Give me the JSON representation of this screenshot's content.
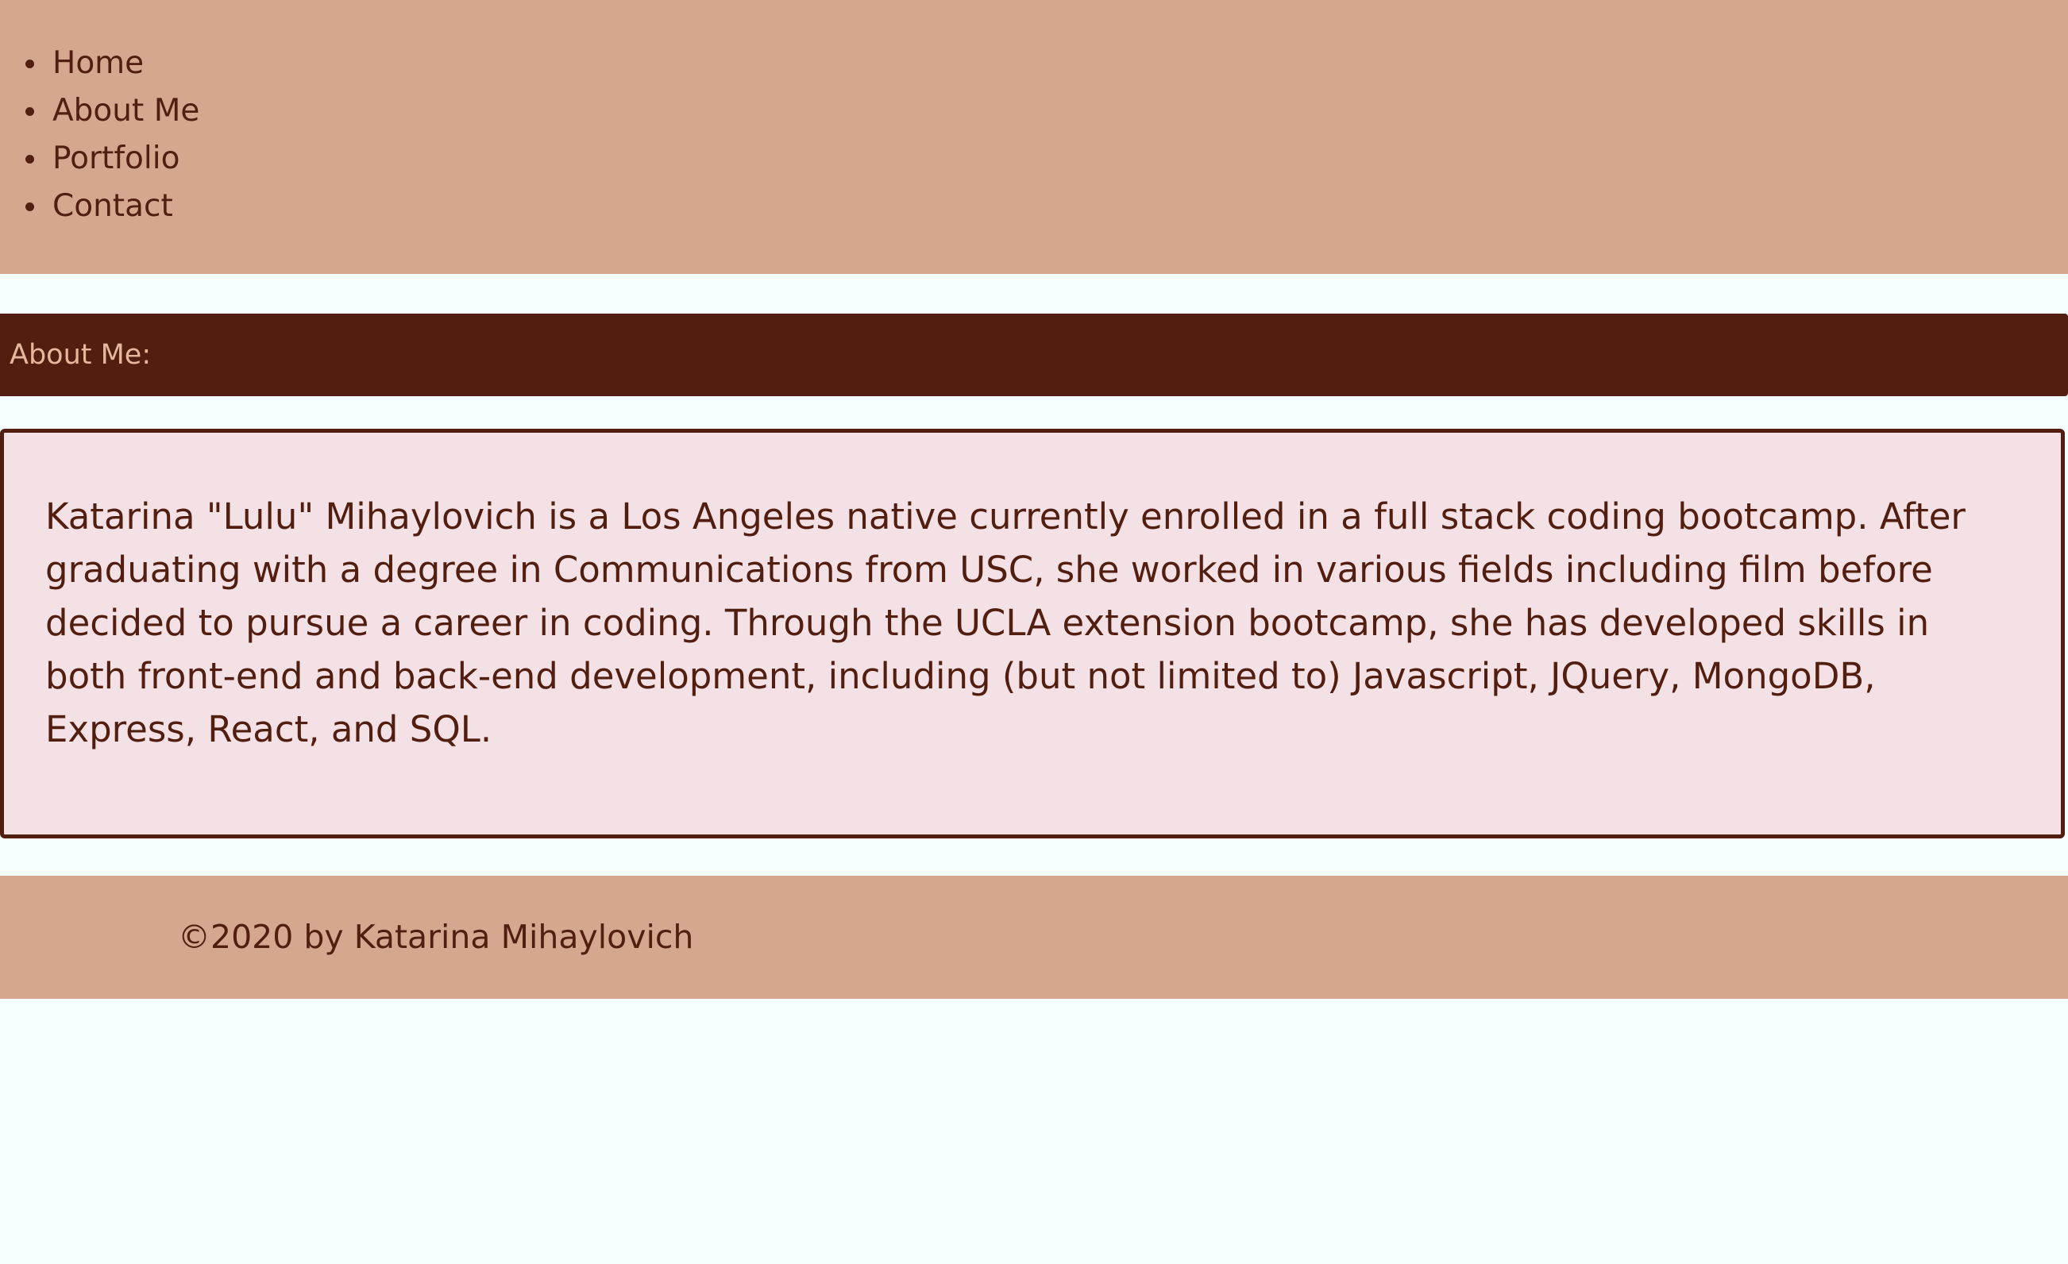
{
  "nav": {
    "items": [
      {
        "label": "Home"
      },
      {
        "label": "About Me"
      },
      {
        "label": "Portfolio"
      },
      {
        "label": "Contact"
      }
    ]
  },
  "section": {
    "title": "About Me:"
  },
  "about": {
    "text": "Katarina \"Lulu\" Mihaylovich is a Los Angeles native currently enrolled in a full stack coding bootcamp. After graduating with a degree in Communications from USC, she worked in various fields including film before decided to pursue a career in coding. Through the UCLA extension bootcamp, she has developed skills in both front-end and back-end development, including (but not limited to) Javascript, JQuery, MongoDB, Express, React, and SQL."
  },
  "footer": {
    "copyright": "©2020 by Katarina Mihaylovich"
  },
  "colors": {
    "nav_bg": "#d5a78f",
    "header_bg": "#521e10",
    "header_text": "#e6b79d",
    "text": "#521e10",
    "box_bg": "#f3e1e6",
    "page_bg": "#f5fffe"
  }
}
